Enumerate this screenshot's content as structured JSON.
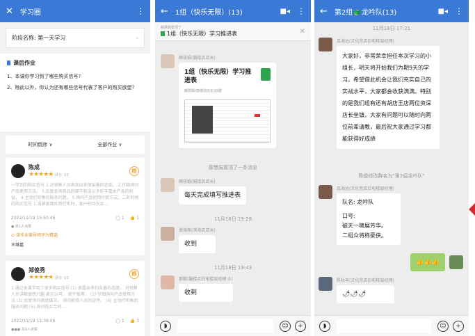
{
  "panel1": {
    "title": "学习圈",
    "stage_label": "阶段名称: 第一天学习",
    "homework_title": "课后作业",
    "question1": "1、本课你学习到了哪些购买信号?",
    "question2": "2、除此以外，你认为还有哪些信号代表了客户的购买欲望?",
    "sort_label": "时间倒序",
    "filter_label": "全部作业",
    "posts": [
      {
        "name": "陈成",
        "score_label": "评分: 10",
        "body": "一学到的购买信号 1.对销售人员表现出来很友善的态度。 2.仔细询问产品使用方法。 3.反复查询商品的细节和设以多彩丰富本产品的利益。 4.主动打听售后服务问题。 5.询问产品使用付款方式。二有利地的购买信号 1.当顾客面反而打听时，客户的目光会...",
        "time": "2022/11/19 15:50:46",
        "comments": "1",
        "likes": "1",
        "liked_by": "共1人点赞",
        "selected_note": "该作业被导师评为精选",
        "commenter": "王维嘉"
      },
      {
        "name": "郑俊秀",
        "score_label": "评分: 10",
        "body": "1.通过本课学到了很多购买信号 (1) 表露出来和友善的态度。 对销售人员讲解很感兴趣 表示认可。 就平板等。 (2) 仔细询问产品使用方法 (3) 反复询问商品细节。 询问能商人员的证件。 (4) 主动打听售后服务问题 (5) 询问购买合同...",
        "time": "2022/11/19 11:38:06",
        "comments": "1",
        "likes": "3",
        "liked_by": "共3人点赞"
      }
    ]
  },
  "panel2": {
    "title": "1组（快乐无限）(13)",
    "pinned_by": "薛慧娟置顶了",
    "pinned_text": "1组（快乐无限）学习推进表",
    "msg1_sender": "薛慧娟(鼓楼店店长)",
    "doc_title": "1组（快乐无限）学习推进表",
    "doc_creator": "薛慧娟(鼓楼店店长)创建",
    "recall_notice": "薛慧娟置顶了一条消息",
    "msg2_sender": "薛慧娟(鼓楼店店长)",
    "msg2_text": "每天完成填写推进表",
    "time1": "11月18日 19:28",
    "msg3_sender": "谢海燕(滨海店店长)",
    "msg3_text": "收到",
    "time2": "11月18日 19:43",
    "msg4_sender": "那鹏(鼓楼店白电楼层经理 ✆)",
    "msg4_text": "收到"
  },
  "panel3": {
    "title": "第2组",
    "title_suffix": "龙吟队(13)",
    "time_top": "11月18日 17:21",
    "msg1_sender": "吕海达(文化宫店白电楼层经理)",
    "msg1_text": "大家好，非常荣幸担任本次学习的小组长，明天将开始我们为期9天的学习，希望借此机会让我们充实自己的实战水平，大家都会收获满满。特别的是我们组有还有胡店王店两位资深店长坐镇，大家有问题可以随时向两位前辈请教，最后祝大家通过学习都能获得好成绩",
    "rename_notice": "陈俊修改群名为\"第2组龙吟队\"",
    "msg2_sender": "吕海达(文化宫店白电楼层经理)",
    "msg2_line1": "队名: 龙吟队",
    "msg2_line2": "口号:",
    "msg2_line3": "破天一啸展芳华。",
    "msg2_line4": "二组众将称豪侠。",
    "msg3_emoji": "👍👍👍",
    "msg4_sender": "陈秋丰(文化宫店白电楼层经理)",
    "msg4_emoji": "🌶🌶🌶"
  },
  "colors": {
    "header": "#3a79d6",
    "star": "#f5a623",
    "accent_orange": "#f0a93a",
    "link_blue": "#3a79d6",
    "green_doc": "#2ea44f"
  }
}
